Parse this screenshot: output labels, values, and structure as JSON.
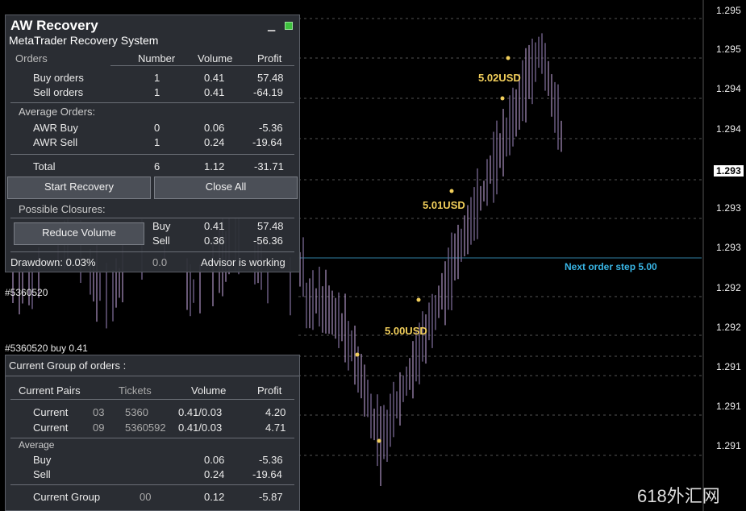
{
  "price_axis": {
    "labels": [
      "1.295",
      "1.295",
      "1.294",
      "1.294",
      "1.293",
      "1.293",
      "1.293",
      "1.292",
      "1.292",
      "1.291",
      "1.291",
      "1.291"
    ],
    "current": "1.293"
  },
  "chart_labels": {
    "profit_1": "5.02USD",
    "profit_2": "5.01USD",
    "profit_3": "5.00USD",
    "news": "Next order step 5.00",
    "order_1": "#5360520",
    "order_2": "#5360520 buy 0.41"
  },
  "top_panel": {
    "title": "AW Recovery",
    "subtitle": "MetaTrader Recovery System",
    "header": {
      "col0": "Orders",
      "col1": "Number",
      "col2": "Volume",
      "col3": "Profit"
    },
    "rows": [
      {
        "label": "Buy orders",
        "number": "1",
        "volume": "0.41",
        "profit": "57.48"
      },
      {
        "label": "Sell orders",
        "number": "1",
        "volume": "0.41",
        "profit": "-64.19"
      }
    ],
    "avg_heading": "Average Orders:",
    "avg_rows": [
      {
        "label": "AWR Buy",
        "number": "0",
        "volume": "0.06",
        "profit": "-5.36"
      },
      {
        "label": "AWR Sell",
        "number": "1",
        "volume": "0.24",
        "profit": "-19.64"
      }
    ],
    "total": {
      "label": "Total",
      "number": "6",
      "volume": "1.12",
      "profit": "-31.71"
    },
    "btn_recovery": "Start Recovery",
    "btn_close_all": "Close All",
    "closures_heading": "Possible Closures:",
    "btn_reduce": "Reduce Volume",
    "closure_rows": [
      {
        "label": "Buy",
        "volume": "0.41",
        "profit": "57.48"
      },
      {
        "label": "Sell",
        "volume": "0.36",
        "profit": "-56.36"
      }
    ],
    "drawdown": "Drawdown: 0.03%",
    "drawdown_pct": "0.0",
    "status": "Advisor is working"
  },
  "bottom_panel": {
    "heading": "Current Group of orders :",
    "header": {
      "col0": "Current Pairs",
      "col1": "Tickets",
      "col2": "Volume",
      "col3": "Profit"
    },
    "rows": [
      {
        "label": "Current",
        "ticket_a": "03",
        "ticket_b": "5360",
        "volume": "0.41/0.03",
        "profit": "4.20"
      },
      {
        "label": "Current",
        "ticket_a": "09",
        "ticket_b": "5360592",
        "volume": "0.41/0.03",
        "profit": "4.71"
      }
    ],
    "avg_heading": "Average",
    "avg_rows": [
      {
        "label": "Buy",
        "volume": "0.06",
        "profit": "-5.36"
      },
      {
        "label": "Sell",
        "volume": "0.24",
        "profit": "-19.64"
      }
    ],
    "group": {
      "label": "Current Group",
      "ticket": "00",
      "volume": "0.12",
      "profit": "-5.87"
    }
  },
  "watermark": "618外汇网",
  "colors": {
    "profit": "#f2cf5b",
    "news": "#39b6e6",
    "candle": "#8a7aa6",
    "panel": "#2d3036"
  }
}
